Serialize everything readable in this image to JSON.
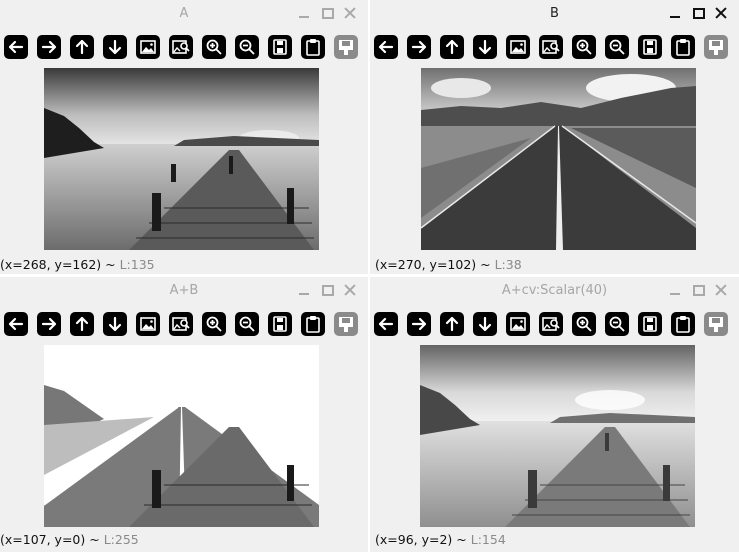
{
  "windows": [
    {
      "title": "A",
      "active": false,
      "status": {
        "coords": "(x=268, y=162) ~",
        "lum": "L:135"
      }
    },
    {
      "title": "B",
      "active": true,
      "status": {
        "coords": "(x=270, y=102) ~",
        "lum": "L:38"
      }
    },
    {
      "title": "A+B",
      "active": false,
      "status": {
        "coords": "(x=107, y=0) ~",
        "lum": "L:255"
      }
    },
    {
      "title": "A+cv:Scalar(40)",
      "active": false,
      "status": {
        "coords": "(x=96, y=2) ~",
        "lum": "L:154"
      }
    }
  ],
  "toolbar_icons": [
    "arrow-left-icon",
    "arrow-right-icon",
    "arrow-up-icon",
    "arrow-down-icon",
    "image-icon",
    "image-search-icon",
    "zoom-in-icon",
    "zoom-out-icon",
    "save-icon",
    "clipboard-icon",
    "save-as-icon"
  ],
  "colors": {
    "background": "#f0f0f0",
    "button": "#000000",
    "disabled_button": "#8a8a8a",
    "inactive_title": "#a6a6a6"
  }
}
